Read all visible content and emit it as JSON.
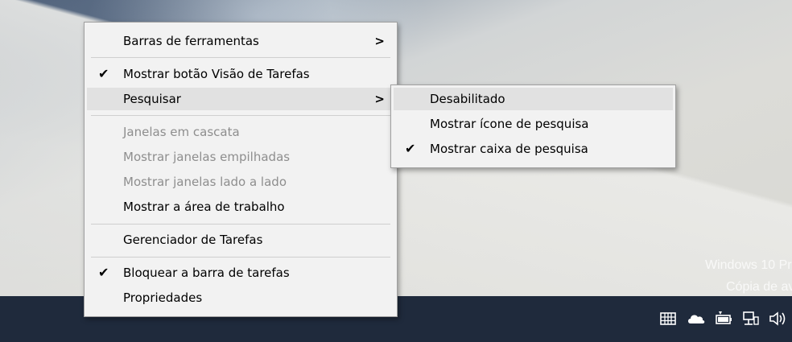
{
  "watermark": {
    "line1": "Windows 10 Pr",
    "line2": "Cópia de av"
  },
  "main_menu": {
    "toolbars": {
      "label": "Barras de ferramentas",
      "submenu_arrow": ">"
    },
    "task_view": {
      "label": "Mostrar botão Visão de Tarefas",
      "checked": true,
      "check": "✔"
    },
    "search": {
      "label": "Pesquisar",
      "submenu_arrow": ">",
      "highlighted": true
    },
    "cascade": {
      "label": "Janelas em cascata",
      "disabled": true
    },
    "stacked": {
      "label": "Mostrar janelas empilhadas",
      "disabled": true
    },
    "side_by_side": {
      "label": "Mostrar janelas lado a lado",
      "disabled": true
    },
    "show_desktop": {
      "label": "Mostrar a área de trabalho"
    },
    "task_manager": {
      "label": "Gerenciador de Tarefas"
    },
    "lock_taskbar": {
      "label": "Bloquear a barra de tarefas",
      "checked": true,
      "check": "✔"
    },
    "properties": {
      "label": "Propriedades"
    }
  },
  "search_submenu": {
    "disabled": {
      "label": "Desabilitado",
      "highlighted": true
    },
    "show_icon": {
      "label": "Mostrar ícone de pesquisa"
    },
    "show_box": {
      "label": "Mostrar caixa de pesquisa",
      "checked": true,
      "check": "✔"
    }
  },
  "tray": {
    "icons": [
      "keyboard-icon",
      "onedrive-icon",
      "battery-icon",
      "network-icon",
      "volume-icon"
    ]
  }
}
